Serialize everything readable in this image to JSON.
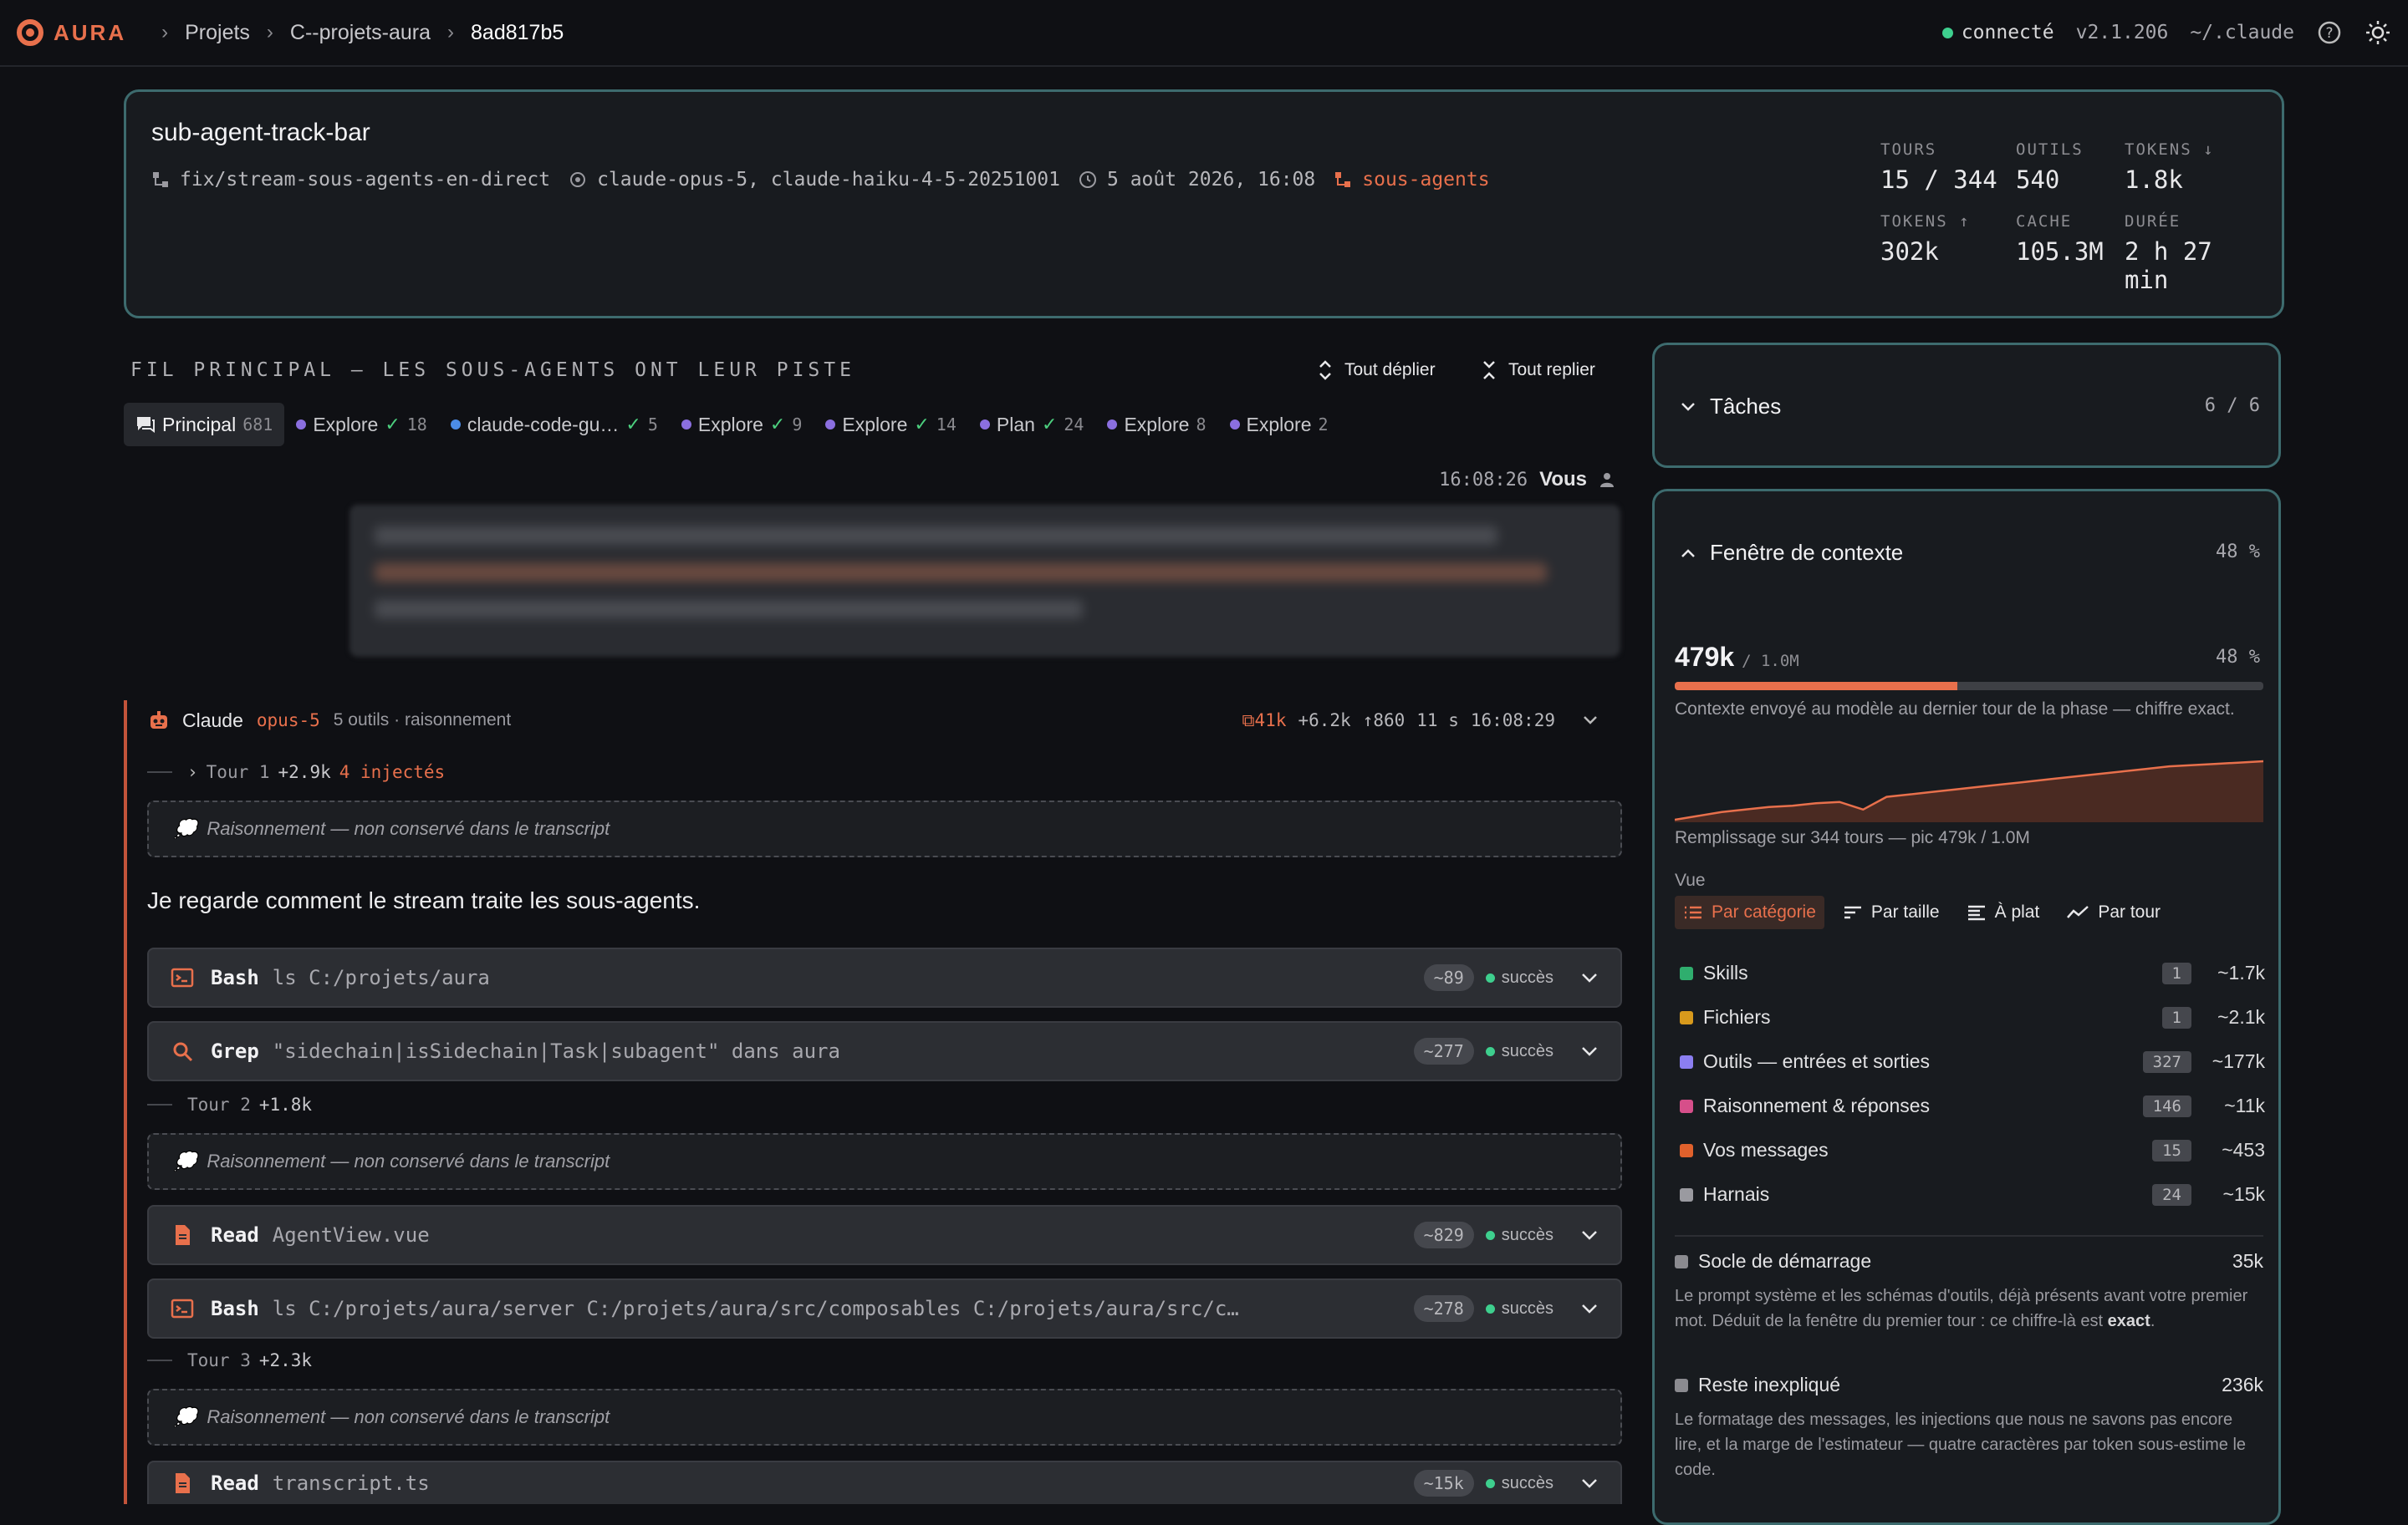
{
  "topbar": {
    "brand": "AURA",
    "breadcrumbs": [
      "Projets",
      "C--projets-aura",
      "8ad817b5"
    ],
    "status": "connecté",
    "version": "v2.1.206",
    "path": "~/.claude"
  },
  "session": {
    "title": "sub-agent-track-bar",
    "branch": "fix/stream-sous-agents-en-direct",
    "models": "claude-opus-5, claude-haiku-4-5-20251001",
    "date": "5 août 2026, 16:08",
    "tag": "sous-agents",
    "stats": [
      {
        "label": "TOURS",
        "value": "15 / 344"
      },
      {
        "label": "OUTILS",
        "value": "540"
      },
      {
        "label": "TOKENS ↓",
        "value": "1.8k"
      },
      {
        "label": "TOKENS ↑",
        "value": "302k"
      },
      {
        "label": "CACHE",
        "value": "105.3M"
      },
      {
        "label": "DURÉE",
        "value": "2 h 27 min"
      }
    ]
  },
  "thread": {
    "title": "FIL PRINCIPAL — LES SOUS-AGENTS ONT LEUR PISTE",
    "expand_all": "Tout déplier",
    "collapse_all": "Tout replier",
    "tabs": [
      {
        "label": "Principal",
        "count": "681",
        "kind": "main"
      },
      {
        "label": "Explore",
        "count": "18",
        "kind": "purple",
        "done": true
      },
      {
        "label": "claude-code-gu…",
        "count": "5",
        "kind": "blue",
        "done": true
      },
      {
        "label": "Explore",
        "count": "9",
        "kind": "purple",
        "done": true
      },
      {
        "label": "Explore",
        "count": "14",
        "kind": "purple",
        "done": true
      },
      {
        "label": "Plan",
        "count": "24",
        "kind": "purple",
        "done": true
      },
      {
        "label": "Explore",
        "count": "8",
        "kind": "purple",
        "done": false
      },
      {
        "label": "Explore",
        "count": "2",
        "kind": "purple",
        "done": false
      }
    ],
    "user_msg": {
      "time": "16:08:26",
      "author": "Vous"
    },
    "assistant": {
      "name": "Claude",
      "model": "opus-5",
      "summary": "5 outils · raisonnement",
      "ctx": "41k",
      "in": "+6.2k",
      "out": "↑860",
      "dur": "11 s",
      "time": "16:08:29"
    },
    "turn1": {
      "label": "Tour 1",
      "delta": "+2.9k",
      "injected": "4 injectés"
    },
    "turn2": {
      "label": "Tour 2",
      "delta": "+1.8k"
    },
    "turn3": {
      "label": "Tour 3",
      "delta": "+2.3k"
    },
    "reasoning_text": "Raisonnement — non conservé dans le transcript",
    "message_text": "Je regarde comment le stream traite les sous-agents.",
    "tools": [
      {
        "name": "Bash",
        "arg": "ls C:/projets/aura",
        "tokens": "~89",
        "status": "succès"
      },
      {
        "name": "Grep",
        "arg": "\"sidechain|isSidechain|Task|subagent\" dans aura",
        "tokens": "~277",
        "status": "succès"
      },
      {
        "name": "Read",
        "arg": "AgentView.vue",
        "tokens": "~829",
        "status": "succès"
      },
      {
        "name": "Bash",
        "arg": "ls C:/projets/aura/server C:/projets/aura/src/composables C:/projets/aura/src/c…",
        "tokens": "~278",
        "status": "succès"
      },
      {
        "name": "Read",
        "arg": "transcript.ts",
        "tokens": "~15k",
        "status": "succès"
      }
    ]
  },
  "tasks": {
    "title": "Tâches",
    "count": "6 / 6"
  },
  "context": {
    "title": "Fenêtre de contexte",
    "pct": "48 %",
    "used": "479k",
    "total": "/ 1.0M",
    "fill_fraction": 0.48,
    "caption": "Contexte envoyé au modèle au dernier tour de la phase — chiffre exact.",
    "sparkline_caption": "Remplissage sur 344 tours — pic 479k / 1.0M",
    "view_label": "Vue",
    "views": [
      "Par catégorie",
      "Par taille",
      "À plat",
      "Par tour"
    ],
    "categories": [
      {
        "label": "Skills",
        "count": "1",
        "tokens": "~1.7k",
        "color": "#2fae6e"
      },
      {
        "label": "Fichiers",
        "count": "1",
        "tokens": "~2.1k",
        "color": "#d89a1c"
      },
      {
        "label": "Outils — entrées et sorties",
        "count": "327",
        "tokens": "~177k",
        "color": "#8b7ef0"
      },
      {
        "label": "Raisonnement & réponses",
        "count": "146",
        "tokens": "~11k",
        "color": "#d64f8a"
      },
      {
        "label": "Vos messages",
        "count": "15",
        "tokens": "~453",
        "color": "#e0612c"
      },
      {
        "label": "Harnais",
        "count": "24",
        "tokens": "~15k",
        "color": "#9a9aa0"
      }
    ],
    "baseline": {
      "label": "Socle de démarrage",
      "value": "35k",
      "desc_a": "Le prompt système et les schémas d'outils, déjà présents avant votre premier mot. Déduit de la fenêtre du premier tour : ce chiffre-là est ",
      "desc_b": "exact",
      "desc_c": "."
    },
    "unexplained": {
      "label": "Reste inexpliqué",
      "value": "236k",
      "desc": "Le formatage des messages, les injections que nous ne savons pas encore lire, et la marge de l'estimateur — quatre caractères par token sous-estime le code."
    },
    "sparkline": [
      0.02,
      0.05,
      0.08,
      0.1,
      0.12,
      0.13,
      0.15,
      0.16,
      0.1,
      0.2,
      0.22,
      0.24,
      0.26,
      0.28,
      0.3,
      0.32,
      0.34,
      0.36,
      0.38,
      0.4,
      0.42,
      0.44,
      0.45,
      0.46,
      0.47,
      0.48
    ]
  }
}
